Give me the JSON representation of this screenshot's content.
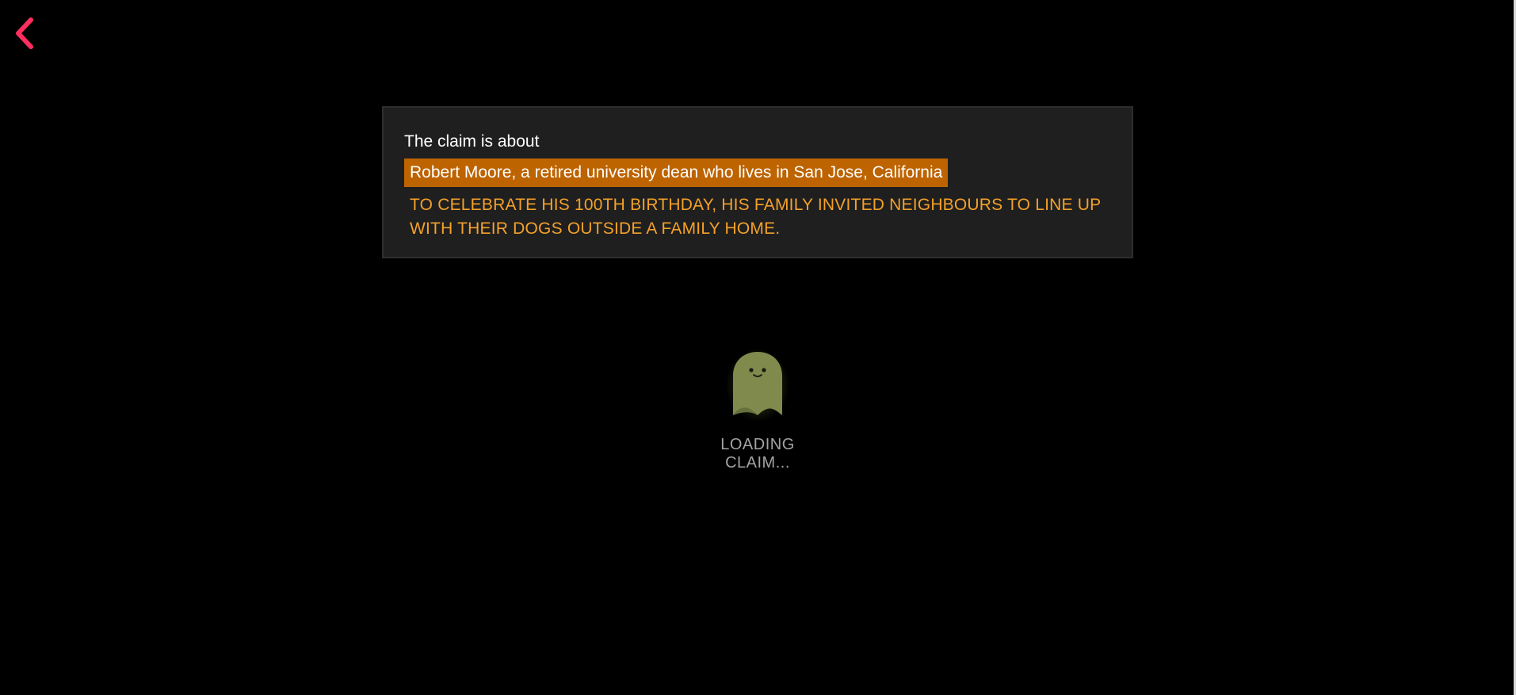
{
  "nav": {
    "back_icon": "chevron-left-icon",
    "accent_color": "#ff2e5f"
  },
  "claim": {
    "intro": "The claim is about",
    "subject": "Robert Moore, a retired university dean who lives in San Jose, California",
    "text": "TO CELEBRATE HIS 100TH BIRTHDAY, HIS FAMILY INVITED NEIGHBOURS TO LINE UP WITH THEIR DOGS OUTSIDE A FAMILY HOME.",
    "subject_bg_color": "#bd6300",
    "text_color": "#f4a12a"
  },
  "loader": {
    "icon": "ghost-icon",
    "label": "LOADING CLAIM..."
  }
}
